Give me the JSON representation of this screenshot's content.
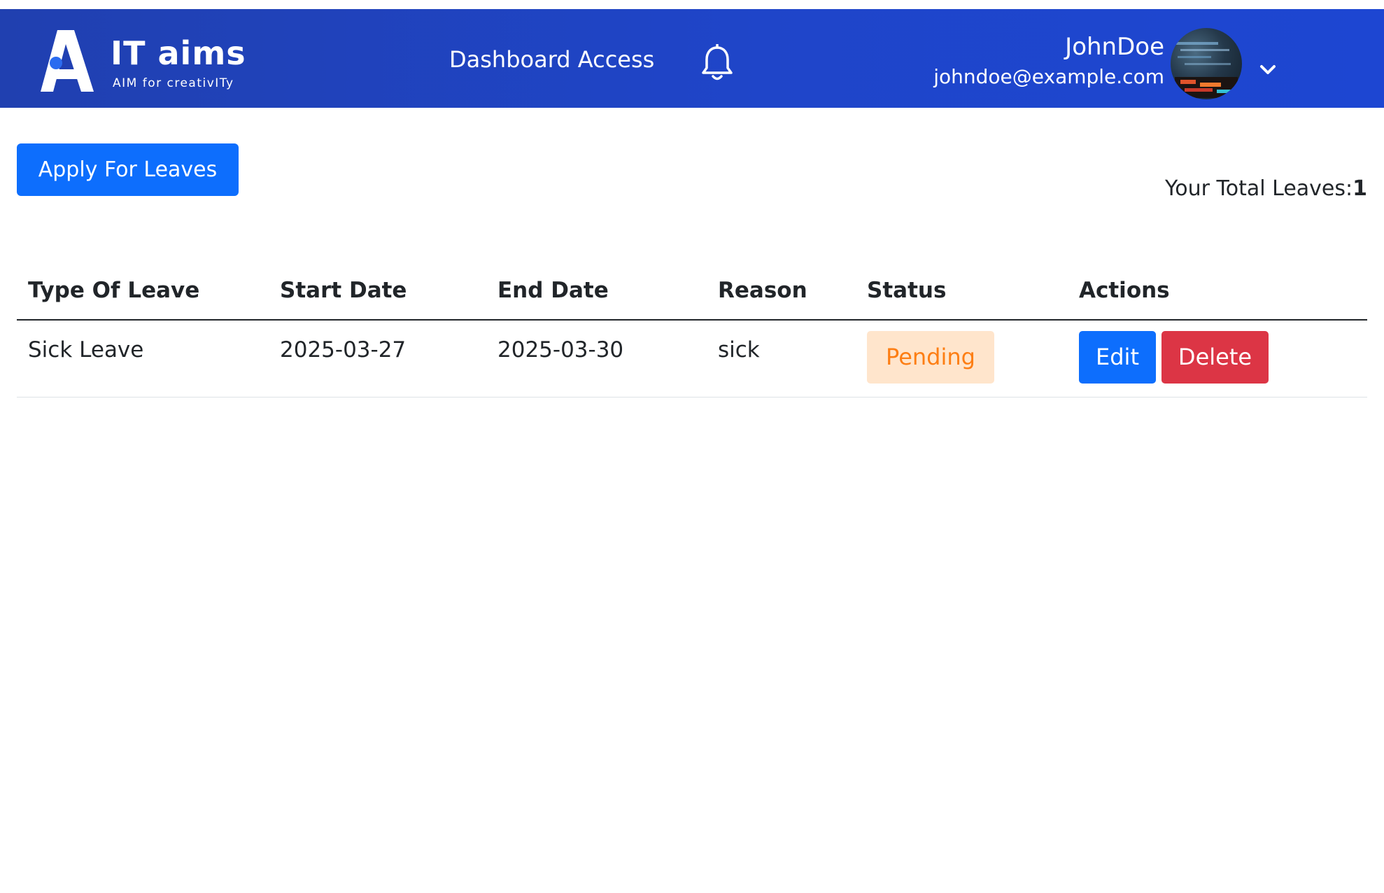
{
  "header": {
    "logo": {
      "title": "IT aims",
      "tagline": "AIM for creativITy"
    },
    "nav_link": "Dashboard Access",
    "notification_icon": "bell-icon",
    "user": {
      "name": "JohnDoe",
      "email": "johndoe@example.com",
      "avatar_icon": "avatar-image",
      "menu_icon": "chevron-down-icon"
    }
  },
  "main": {
    "apply_button": "Apply For Leaves",
    "total_leaves_label": "Your Total Leaves:",
    "total_leaves_value": "1",
    "table": {
      "columns": [
        "Type Of Leave",
        "Start Date",
        "End Date",
        "Reason",
        "Status",
        "Actions"
      ],
      "rows": [
        {
          "type": "Sick Leave",
          "start_date": "2025-03-27",
          "end_date": "2025-03-30",
          "reason": "sick",
          "status": "Pending",
          "edit_label": "Edit",
          "delete_label": "Delete"
        }
      ]
    }
  },
  "colors": {
    "header_bg": "#1f45c9",
    "primary": "#0d6efd",
    "danger": "#dc3545",
    "pending_text": "#fd7e14",
    "pending_bg": "#ffe5cc"
  }
}
